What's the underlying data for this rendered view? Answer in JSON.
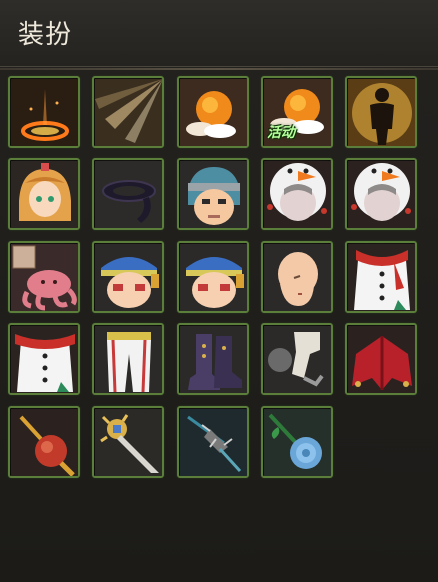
{
  "window": {
    "title": "装扮"
  },
  "slots": [
    {
      "icon": "fire-ring-aura-icon"
    },
    {
      "icon": "light-rays-aura-icon"
    },
    {
      "icon": "sun-cloud-aura-icon"
    },
    {
      "icon": "sun-cloud-event-aura-icon",
      "tag": "活动"
    },
    {
      "icon": "golden-silhouette-aura-icon"
    },
    {
      "icon": "blonde-girl-head-icon"
    },
    {
      "icon": "black-headband-icon"
    },
    {
      "icon": "ninja-boy-head-icon"
    },
    {
      "icon": "snowman-hood-head-icon"
    },
    {
      "icon": "snowman-hood-head-icon"
    },
    {
      "icon": "pink-octopus-icon"
    },
    {
      "icon": "blue-cap-face-icon"
    },
    {
      "icon": "blue-cap-face-icon"
    },
    {
      "icon": "bald-head-icon"
    },
    {
      "icon": "snowman-coat-icon"
    },
    {
      "icon": "snowman-coat-scarf-icon"
    },
    {
      "icon": "white-pants-icon"
    },
    {
      "icon": "purple-boots-icon"
    },
    {
      "icon": "gauntlet-icon"
    },
    {
      "icon": "red-jester-cape-icon"
    },
    {
      "icon": "red-mace-icon"
    },
    {
      "icon": "golden-sword-icon"
    },
    {
      "icon": "spiked-claw-icon"
    },
    {
      "icon": "blue-rose-icon"
    }
  ]
}
